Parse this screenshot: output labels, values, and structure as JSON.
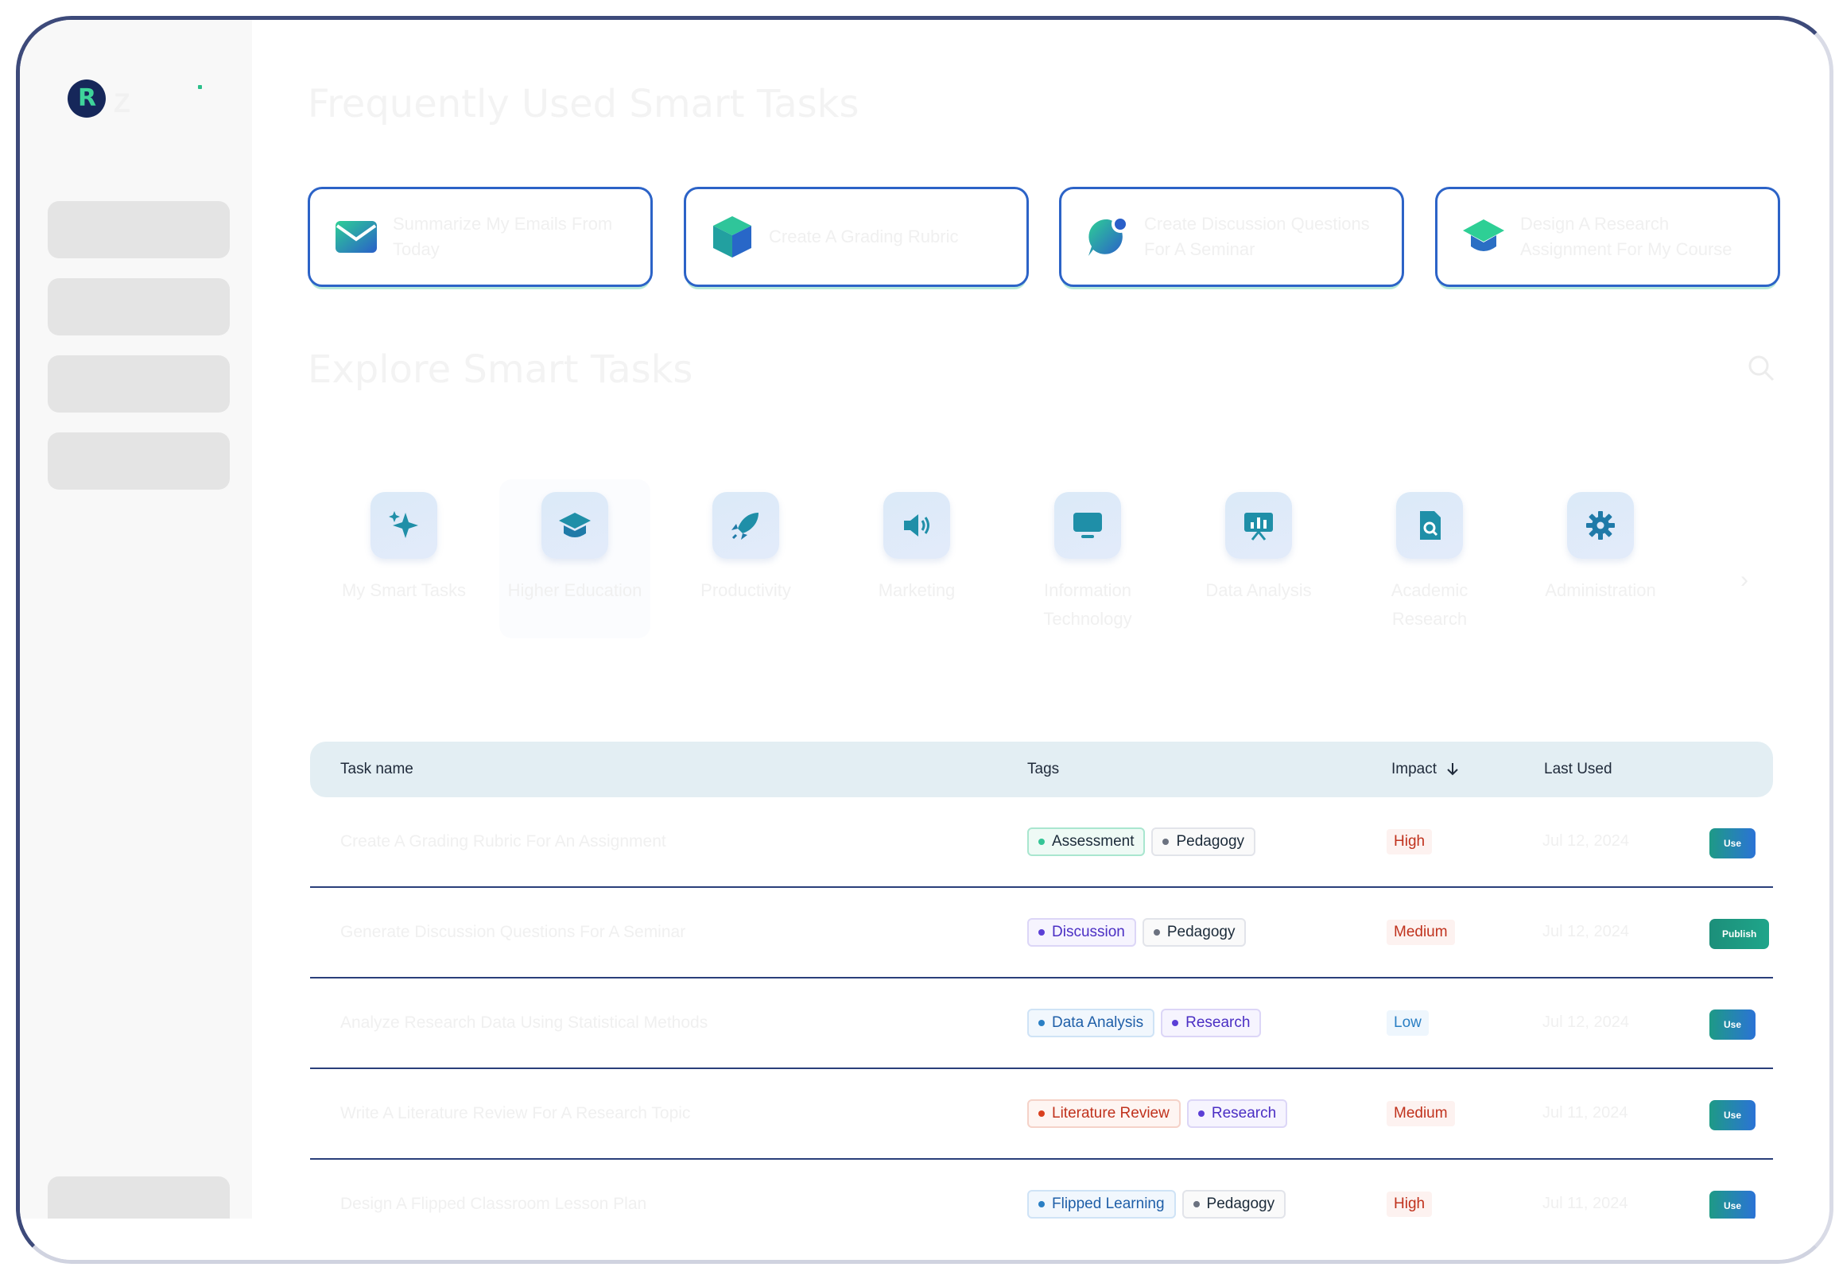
{
  "brand": {
    "name": "Z"
  },
  "favorites": {
    "title": "Frequently Used Smart Tasks",
    "cards": [
      {
        "icon": "envelope-icon",
        "label": "Summarize My Emails From Today"
      },
      {
        "icon": "cube-icon",
        "label": "Create A Grading Rubric"
      },
      {
        "icon": "chat-bubble-icon",
        "label": "Create Discussion Questions For A Seminar"
      },
      {
        "icon": "graduation-cap-icon",
        "label": "Design A Research Assignment For My Course"
      }
    ]
  },
  "explore": {
    "title": "Explore Smart Tasks",
    "categories": [
      {
        "icon": "sparkles-icon",
        "label": "My Smart Tasks"
      },
      {
        "icon": "graduation-cap-icon",
        "label": "Higher Education"
      },
      {
        "icon": "rocket-icon",
        "label": "Productivity"
      },
      {
        "icon": "megaphone-icon",
        "label": "Marketing"
      },
      {
        "icon": "monitor-icon",
        "label": "Information Technology"
      },
      {
        "icon": "presentation-icon",
        "label": "Data Analysis"
      },
      {
        "icon": "document-search-icon",
        "label": "Academic Research"
      },
      {
        "icon": "gear-icon",
        "label": "Administration"
      }
    ]
  },
  "table": {
    "headers": {
      "name": "Task name",
      "tags": "Tags",
      "impact": "Impact",
      "last": "Last Used"
    },
    "rows": [
      {
        "name": "Create A Grading Rubric For An Assignment",
        "tags": [
          "Assessment",
          "Pedagogy"
        ],
        "impact": "High",
        "last": "Jul 12, 2024",
        "action": "Use"
      },
      {
        "name": "Generate Discussion Questions For A Seminar",
        "tags": [
          "Discussion",
          "Pedagogy"
        ],
        "impact": "Medium",
        "last": "Jul 12, 2024",
        "action": "Publish"
      },
      {
        "name": "Analyze Research Data Using Statistical Methods",
        "tags": [
          "Data Analysis",
          "Research"
        ],
        "impact": "Low",
        "last": "Jul 12, 2024",
        "action": "Use"
      },
      {
        "name": "Write A Literature Review For A Research Topic",
        "tags": [
          "Literature Review",
          "Research"
        ],
        "impact": "Medium",
        "last": "Jul 11, 2024",
        "action": "Use"
      },
      {
        "name": "Design A Flipped Classroom Lesson Plan",
        "tags": [
          "Flipped Learning",
          "Pedagogy"
        ],
        "impact": "High",
        "last": "Jul 11, 2024",
        "action": "Use"
      }
    ]
  },
  "colors": {
    "accent_blue": "#2c63c7",
    "green_dot": "#34c596",
    "high": "#c0321d",
    "medium": "#c0321d",
    "low": "#2a7fc4"
  }
}
